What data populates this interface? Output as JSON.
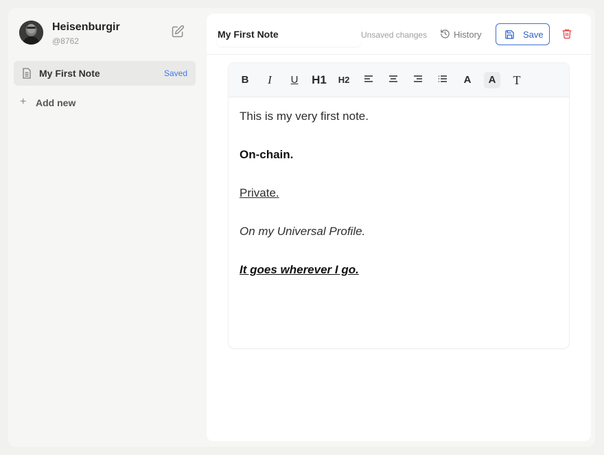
{
  "user": {
    "name": "Heisenburgir",
    "handle": "@8762"
  },
  "sidebar": {
    "notes": [
      {
        "title": "My First Note",
        "status": "Saved"
      }
    ],
    "add_new_label": "Add new"
  },
  "editor": {
    "title_value": "My First Note",
    "unsaved_label": "Unsaved changes",
    "history_label": "History",
    "save_label": "Save",
    "toolbar": {
      "bold": "B",
      "italic": "I",
      "underline": "U",
      "h1": "H1",
      "h2": "H2",
      "text_color": "A",
      "highlight": "A",
      "clear_format": "T"
    },
    "paragraphs": {
      "p1": "This is my very first note.",
      "p2": "On-chain.",
      "p3": "Private.",
      "p4": "On my Universal Profile.",
      "p5": "It goes wherever I go."
    }
  },
  "colors": {
    "accent": "#3d6fd6",
    "saved": "#3d7bea",
    "danger": "#e5484d"
  },
  "icons": [
    "edit-icon",
    "document-icon",
    "plus-icon",
    "history-icon",
    "save-icon",
    "trash-icon"
  ]
}
